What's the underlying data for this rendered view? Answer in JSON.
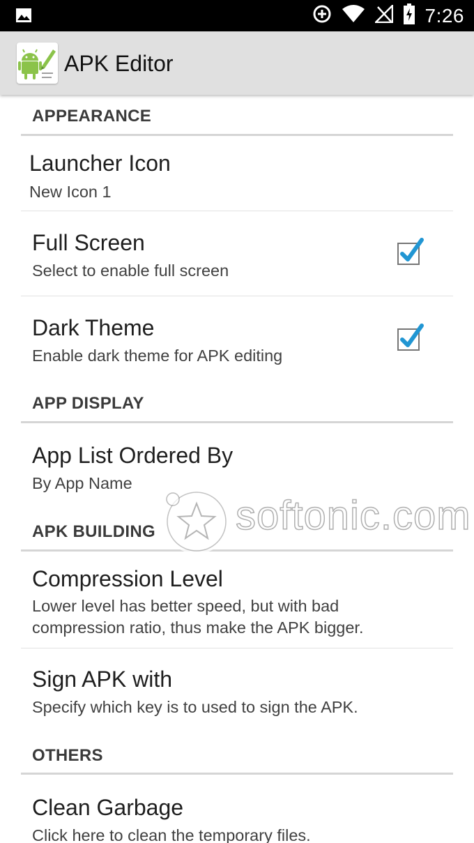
{
  "status_bar": {
    "time": "7:26",
    "icons": [
      "image-icon",
      "data-saver-icon",
      "wifi-icon",
      "no-signal-icon",
      "battery-charging-icon"
    ]
  },
  "toolbar": {
    "title": "APK Editor",
    "logo_icon": "apk-editor-android-logo-icon"
  },
  "sections": {
    "appearance": {
      "header": "APPEARANCE",
      "launcher_icon": {
        "title": "Launcher Icon",
        "summary": "New Icon 1"
      },
      "full_screen": {
        "title": "Full Screen",
        "summary": "Select to enable full screen",
        "checked": true
      },
      "dark_theme": {
        "title": "Dark Theme",
        "summary": "Enable dark theme for APK editing",
        "checked": true
      }
    },
    "app_display": {
      "header": "APP DISPLAY",
      "app_list_ordered_by": {
        "title": "App List Ordered By",
        "summary": "By App Name"
      }
    },
    "apk_building": {
      "header": "APK BUILDING",
      "compression_level": {
        "title": "Compression Level",
        "summary_line1": "Lower level has better speed, but with bad",
        "summary_line2": "compression ratio, thus make the APK bigger."
      },
      "sign_apk_with": {
        "title": "Sign APK with",
        "summary": "Specify which key is to used to sign the APK."
      }
    },
    "others": {
      "header": "OTHERS",
      "clean_garbage": {
        "title": "Clean Garbage",
        "summary": "Click here to clean the temporary files."
      }
    }
  },
  "watermark": {
    "text": "softonic.com"
  },
  "colors": {
    "accent": "#2196d3",
    "toolbar_bg": "#e0e0e0",
    "status_bar_bg": "#000000"
  }
}
